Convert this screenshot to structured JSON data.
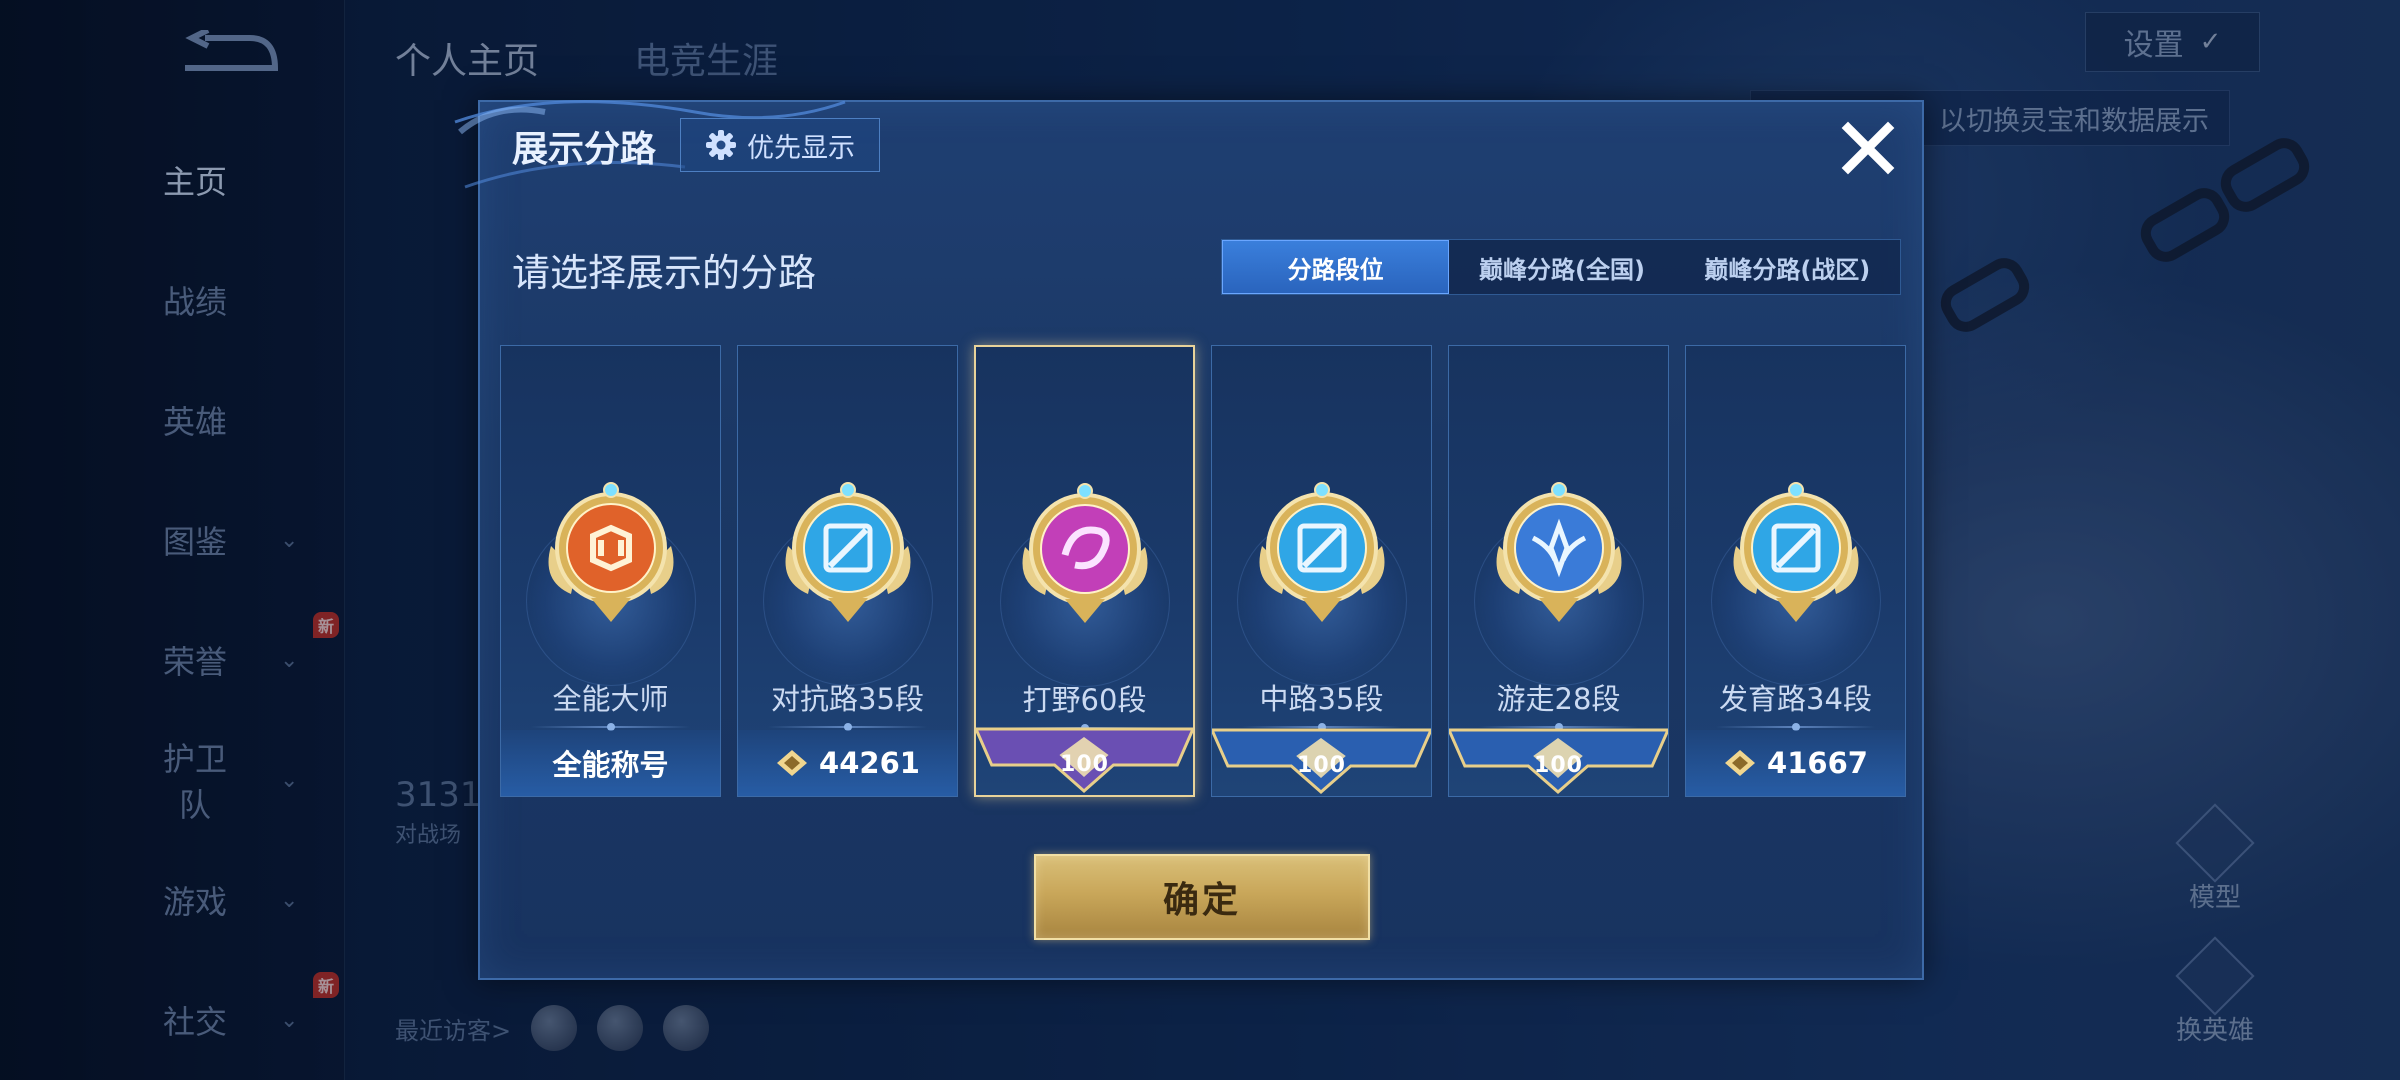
{
  "nav": {
    "items": [
      {
        "label": "主页",
        "active": true,
        "chevron": false,
        "new": false
      },
      {
        "label": "战绩",
        "active": false,
        "chevron": false,
        "new": false
      },
      {
        "label": "英雄",
        "active": false,
        "chevron": false,
        "new": false
      },
      {
        "label": "图鉴",
        "active": false,
        "chevron": true,
        "new": false
      },
      {
        "label": "荣誉",
        "active": false,
        "chevron": true,
        "new": true
      },
      {
        "label": "护卫队",
        "active": false,
        "chevron": true,
        "new": false
      },
      {
        "label": "游戏",
        "active": false,
        "chevron": true,
        "new": false
      },
      {
        "label": "社交",
        "active": false,
        "chevron": true,
        "new": true
      }
    ],
    "new_badge": "新"
  },
  "top_tabs": [
    "个人主页",
    "电竞生涯"
  ],
  "settings_label": "设置",
  "hint_text": "以切换灵宝和数据展示",
  "profile": {
    "number": "3131",
    "sub": "对战场"
  },
  "recent_visitors_label": "最近访客>",
  "side_buttons": {
    "model": "模型",
    "change_hero": "换英雄"
  },
  "modal": {
    "title": "展示分路",
    "priority_label": "优先显示",
    "subtitle": "请选择展示的分路",
    "segments": [
      {
        "label": "分路段位",
        "active": true
      },
      {
        "label": "巅峰分路(全国)",
        "active": false
      },
      {
        "label": "巅峰分路(战区)",
        "active": false
      }
    ],
    "cards": [
      {
        "name": "全能大师",
        "footer": "全能称号",
        "footer_type": "text",
        "badge_color": "#e0622a",
        "selected": false
      },
      {
        "name": "对抗路35段",
        "footer": "44261",
        "footer_type": "score",
        "badge_color": "#2fa6e6",
        "selected": false
      },
      {
        "name": "打野60段",
        "footer": "100",
        "footer_type": "ribbon",
        "ribbon_color": "#6a4fb3",
        "badge_color": "#c23fb8",
        "selected": true
      },
      {
        "name": "中路35段",
        "footer": "100",
        "footer_type": "ribbon",
        "ribbon_color": "#2a5fb0",
        "badge_color": "#2fa6e6",
        "selected": false
      },
      {
        "name": "游走28段",
        "footer": "100",
        "footer_type": "ribbon",
        "ribbon_color": "#2a5fb0",
        "badge_color": "#3a7bd8",
        "selected": false
      },
      {
        "name": "发育路34段",
        "footer": "41667",
        "footer_type": "score",
        "badge_color": "#2fa6e6",
        "selected": false
      }
    ],
    "confirm_label": "确定"
  }
}
